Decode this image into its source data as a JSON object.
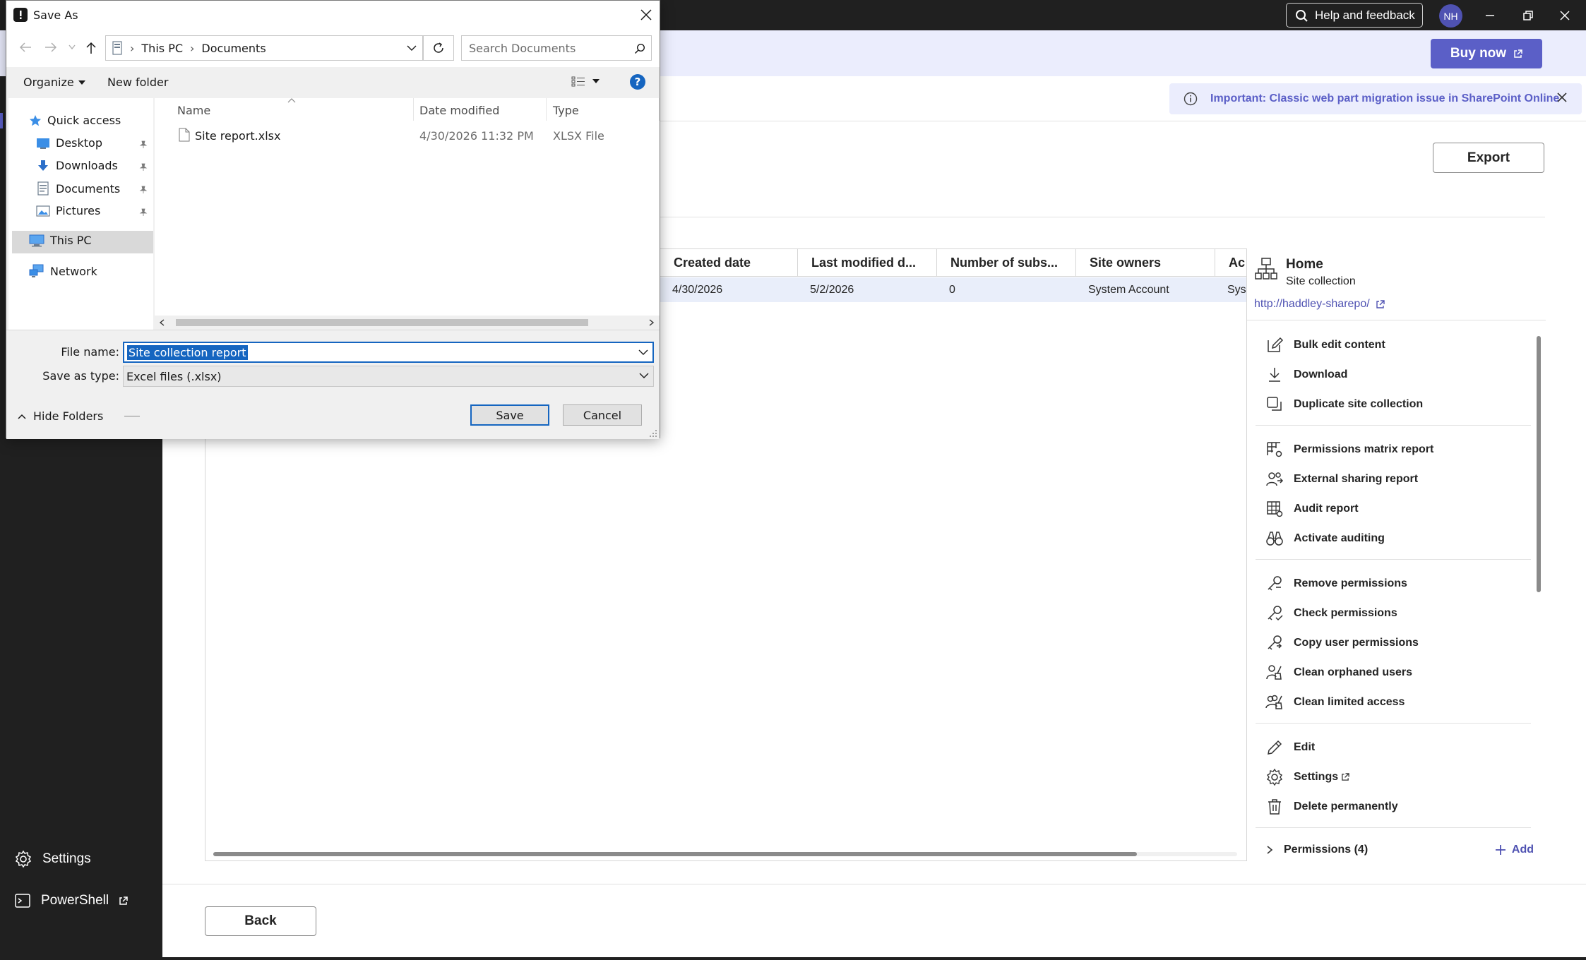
{
  "app": {
    "help_label": "Help and feedback",
    "avatar_initials": "NH",
    "buy_now_label": "Buy now",
    "notice_text": "Important: Classic web part migration issue in SharePoint Online",
    "export_label": "Export",
    "back_label": "Back",
    "accent_color": "#5b5fc7"
  },
  "left_nav": {
    "settings_label": "Settings",
    "powershell_label": "PowerShell"
  },
  "grid": {
    "columns": [
      "Created date",
      "Last modified d...",
      "Number of subs...",
      "Site owners",
      "Ac"
    ],
    "row": [
      "4/30/2026",
      "5/2/2026",
      "0",
      "System Account",
      "Sys"
    ]
  },
  "side_panel": {
    "title": "Home",
    "subtitle": "Site collection",
    "link": "http://haddley-sharepo/",
    "actions_group1": [
      "Bulk edit content",
      "Download",
      "Duplicate site collection"
    ],
    "actions_group2": [
      "Permissions matrix report",
      "External sharing report",
      "Audit report",
      "Activate auditing"
    ],
    "actions_group3": [
      "Remove permissions",
      "Check permissions",
      "Copy user permissions",
      "Clean orphaned users",
      "Clean limited access"
    ],
    "actions_group4": [
      "Edit",
      "Settings",
      "Delete permanently"
    ],
    "permissions_label": "Permissions (4)",
    "add_label": "Add"
  },
  "dialog": {
    "title": "Save As",
    "breadcrumb": [
      "This PC",
      "Documents"
    ],
    "search_placeholder": "Search Documents",
    "organize_label": "Organize",
    "new_folder_label": "New folder",
    "nav_tree": {
      "quick_access": "Quick access",
      "desktop": "Desktop",
      "downloads": "Downloads",
      "documents": "Documents",
      "pictures": "Pictures",
      "this_pc": "This PC",
      "network": "Network"
    },
    "file_columns": [
      "Name",
      "Date modified",
      "Type"
    ],
    "files": [
      {
        "name": "Site report.xlsx",
        "modified": "4/30/2026 11:32 PM",
        "type": "XLSX File"
      }
    ],
    "file_name_label": "File name:",
    "file_name_value": "Site collection report",
    "save_type_label": "Save as type:",
    "save_type_value": "Excel files (.xlsx)",
    "hide_folders_label": "Hide Folders",
    "save_label": "Save",
    "cancel_label": "Cancel"
  }
}
